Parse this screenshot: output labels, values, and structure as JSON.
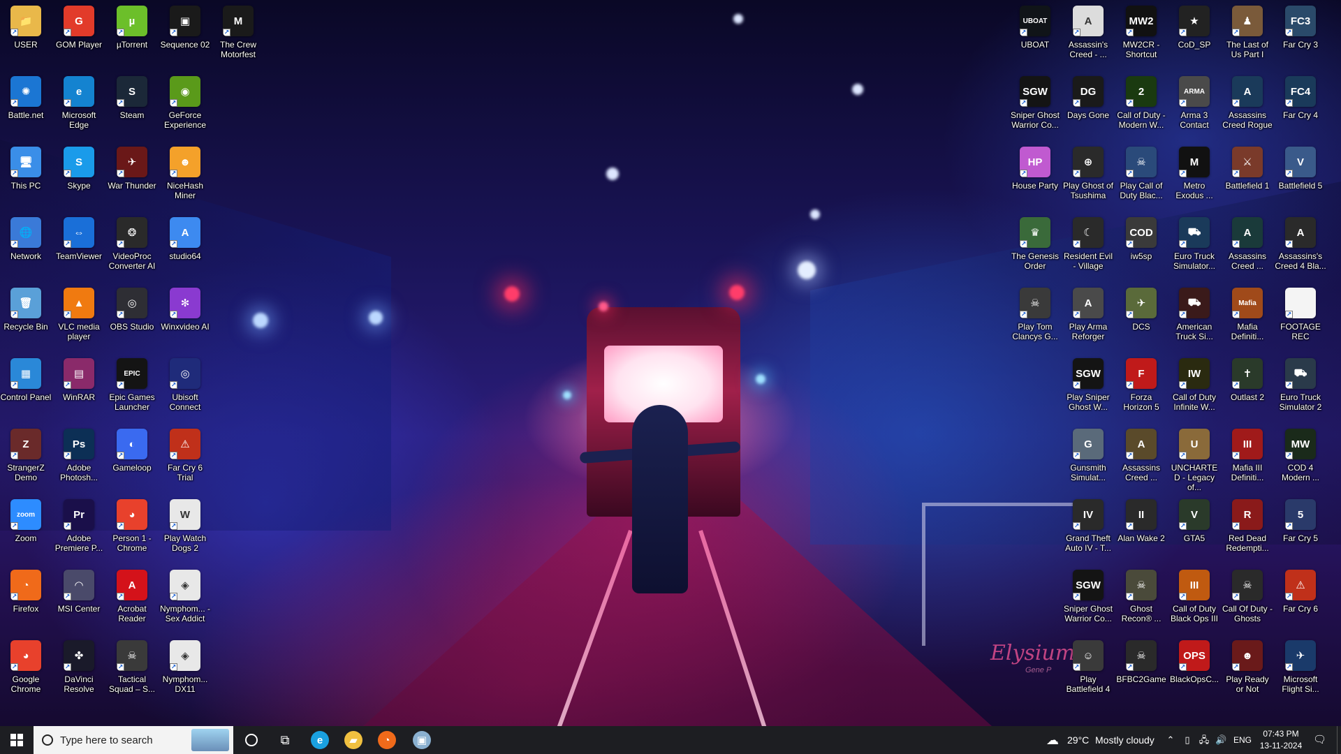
{
  "desktop": {
    "watermark": {
      "text": "Elysium",
      "sub": "Gene P"
    },
    "left_icons": [
      {
        "label": "USER",
        "glyph": "📁",
        "color": "#e9b84a"
      },
      {
        "label": "GOM Player",
        "glyph": "G",
        "color": "#e23b2a"
      },
      {
        "label": "µTorrent",
        "glyph": "µ",
        "color": "#6cbf2a"
      },
      {
        "label": "Sequence 02",
        "glyph": "▣",
        "color": "#1a1a1a"
      },
      {
        "label": "The Crew Motorfest",
        "glyph": "M",
        "color": "#1a1a1a"
      },
      {
        "label": "Battle.net",
        "glyph": "✺",
        "color": "#1b76d3"
      },
      {
        "label": "Microsoft Edge",
        "glyph": "e",
        "color": "#1483d0"
      },
      {
        "label": "Steam",
        "glyph": "S",
        "color": "#1b2838"
      },
      {
        "label": "GeForce Experience",
        "glyph": "◉",
        "color": "#5a9a1a"
      },
      {
        "label": "This PC",
        "glyph": "🖥",
        "color": "#3a8ee8"
      },
      {
        "label": "Skype",
        "glyph": "S",
        "color": "#1a9bea"
      },
      {
        "label": "War Thunder",
        "glyph": "✈",
        "color": "#6a1818"
      },
      {
        "label": "NiceHash Miner",
        "glyph": "☻",
        "color": "#f4a12a"
      },
      {
        "label": "Network",
        "glyph": "🌐",
        "color": "#3a7ad8"
      },
      {
        "label": "TeamViewer",
        "glyph": "⇔",
        "color": "#1a6fd8"
      },
      {
        "label": "VideoProc Converter AI",
        "glyph": "❂",
        "color": "#2a2a2a"
      },
      {
        "label": "studio64",
        "glyph": "A",
        "color": "#3d8af0"
      },
      {
        "label": "Recycle Bin",
        "glyph": "🗑",
        "color": "#5aa0d8"
      },
      {
        "label": "VLC media player",
        "glyph": "▲",
        "color": "#f07a10"
      },
      {
        "label": "OBS Studio",
        "glyph": "◎",
        "color": "#2e2e34"
      },
      {
        "label": "Winxvideo AI",
        "glyph": "✻",
        "color": "#8a3ad0"
      },
      {
        "label": "Control Panel",
        "glyph": "▦",
        "color": "#2a88d8"
      },
      {
        "label": "WinRAR",
        "glyph": "▤",
        "color": "#8a2a6a"
      },
      {
        "label": "Epic Games Launcher",
        "glyph": "EPIC",
        "color": "#141414"
      },
      {
        "label": "Ubisoft Connect",
        "glyph": "◎",
        "color": "#1f2b7a"
      },
      {
        "label": "StrangerZ Demo",
        "glyph": "Z",
        "color": "#6a2a2a"
      },
      {
        "label": "Adobe Photosh...",
        "glyph": "Ps",
        "color": "#0c2f55"
      },
      {
        "label": "Gameloop",
        "glyph": "◐",
        "color": "#3a6af0"
      },
      {
        "label": "Far Cry 6 Trial",
        "glyph": "⚠",
        "color": "#c0301a"
      },
      {
        "label": "Zoom",
        "glyph": "zoom",
        "color": "#2d8cff"
      },
      {
        "label": "Adobe Premiere P...",
        "glyph": "Pr",
        "color": "#1a0f4a"
      },
      {
        "label": "Person 1 - Chrome",
        "glyph": "◕",
        "color": "#e8412c"
      },
      {
        "label": "Play Watch Dogs 2",
        "glyph": "W",
        "color": "#e8e8e8"
      },
      {
        "label": "Firefox",
        "glyph": "◔",
        "color": "#f06a1a"
      },
      {
        "label": "MSI Center",
        "glyph": "◠",
        "color": "#4a4a6a"
      },
      {
        "label": "Acrobat Reader",
        "glyph": "A",
        "color": "#d4121a"
      },
      {
        "label": "Nymphom... - Sex Addict",
        "glyph": "◈",
        "color": "#e8e8e8"
      },
      {
        "label": "Google Chrome",
        "glyph": "◕",
        "color": "#e8412c"
      },
      {
        "label": "DaVinci Resolve",
        "glyph": "✤",
        "color": "#1a1a2a"
      },
      {
        "label": "Tactical Squad – S...",
        "glyph": "☠",
        "color": "#3a3a3a"
      },
      {
        "label": "Nymphom... DX11",
        "glyph": "◈",
        "color": "#e8e8e8"
      }
    ],
    "right_icons": [
      {
        "label": "UBOAT",
        "glyph": "UBOAT",
        "color": "#101418"
      },
      {
        "label": "Assassin's Creed - ...",
        "glyph": "A",
        "color": "#dcdcdc"
      },
      {
        "label": "MW2CR - Shortcut",
        "glyph": "MW2",
        "color": "#111"
      },
      {
        "label": "CoD_SP",
        "glyph": "★",
        "color": "#222"
      },
      {
        "label": "The Last of Us Part I",
        "glyph": "♟",
        "color": "#7a5a3a"
      },
      {
        "label": "Far Cry 3",
        "glyph": "FC3",
        "color": "#2a4a6a"
      },
      {
        "label": "Sniper Ghost Warrior Co...",
        "glyph": "SGW",
        "color": "#141414"
      },
      {
        "label": "Days Gone",
        "glyph": "DG",
        "color": "#1a1a1a"
      },
      {
        "label": "Call of Duty - Modern W...",
        "glyph": "2",
        "color": "#1a3a10"
      },
      {
        "label": "Arma 3 Contact",
        "glyph": "ARMA",
        "color": "#4a4a4a"
      },
      {
        "label": "Assassins Creed Rogue",
        "glyph": "A",
        "color": "#1a3a5a"
      },
      {
        "label": "Far Cry 4",
        "glyph": "FC4",
        "color": "#1a3a5a"
      },
      {
        "label": "House Party",
        "glyph": "HP",
        "color": "#c05ad0"
      },
      {
        "label": "Play Ghost of Tsushima",
        "glyph": "⊕",
        "color": "#2a2a2a"
      },
      {
        "label": "Play Call of Duty Blac...",
        "glyph": "☠",
        "color": "#2a4a7a"
      },
      {
        "label": "Metro Exodus ...",
        "glyph": "M",
        "color": "#111"
      },
      {
        "label": "Battlefield 1",
        "glyph": "⚔",
        "color": "#7a3a2a"
      },
      {
        "label": "Battlefield 5",
        "glyph": "V",
        "color": "#3a5a8a"
      },
      {
        "label": "The Genesis Order",
        "glyph": "♛",
        "color": "#3a6a3a"
      },
      {
        "label": "Resident Evil - Village",
        "glyph": "☾",
        "color": "#2a2a2a"
      },
      {
        "label": "iw5sp",
        "glyph": "COD",
        "color": "#3a3a3a"
      },
      {
        "label": "Euro Truck Simulator...",
        "glyph": "⛟",
        "color": "#1a3a5a"
      },
      {
        "label": "Assassins Creed ...",
        "glyph": "A",
        "color": "#1a3a3a"
      },
      {
        "label": "Assassins's Creed 4 Bla...",
        "glyph": "A",
        "color": "#2a2a2a"
      },
      {
        "label": "Play Tom Clancys G...",
        "glyph": "☠",
        "color": "#3a3a3a"
      },
      {
        "label": "Play Arma Reforger",
        "glyph": "A",
        "color": "#4a4a4a"
      },
      {
        "label": "DCS",
        "glyph": "✈",
        "color": "#5a6a3a"
      },
      {
        "label": "American Truck Si...",
        "glyph": "⛟",
        "color": "#3a1a1a"
      },
      {
        "label": "Mafia Definiti...",
        "glyph": "Mafia",
        "color": "#a04a1a"
      },
      {
        "label": "FOOTAGE REC",
        "glyph": "",
        "color": "#f4f4f4"
      },
      {
        "label": "Play Sniper Ghost W...",
        "glyph": "SGW",
        "color": "#141414"
      },
      {
        "label": "Forza Horizon 5",
        "glyph": "F",
        "color": "#c01a1a"
      },
      {
        "label": "Call of Duty Infinite W...",
        "glyph": "IW",
        "color": "#2a2a10"
      },
      {
        "label": "Outlast 2",
        "glyph": "✝",
        "color": "#2a3a2a"
      },
      {
        "label": "Euro Truck Simulator 2",
        "glyph": "⛟",
        "color": "#2a3a4a"
      },
      {
        "label": "Gunsmith Simulat...",
        "glyph": "G",
        "color": "#5a6a7a"
      },
      {
        "label": "Assassins Creed ...",
        "glyph": "A",
        "color": "#5a4a2a"
      },
      {
        "label": "UNCHARTED - Legacy of...",
        "glyph": "U",
        "color": "#8a6a3a"
      },
      {
        "label": "Mafia III Definiti...",
        "glyph": "III",
        "color": "#a01a1a"
      },
      {
        "label": "COD 4 Modern ...",
        "glyph": "MW",
        "color": "#1a2a1a"
      },
      {
        "label": "Grand Theft Auto IV - T...",
        "glyph": "IV",
        "color": "#2a2a2a"
      },
      {
        "label": "Alan Wake 2",
        "glyph": "II",
        "color": "#2a2a2a"
      },
      {
        "label": "GTA5",
        "glyph": "V",
        "color": "#2a3a2a"
      },
      {
        "label": "Red Dead Redempti...",
        "glyph": "R",
        "color": "#8a1a1a"
      },
      {
        "label": "Far Cry 5",
        "glyph": "5",
        "color": "#2a3a6a"
      },
      {
        "label": "Sniper Ghost Warrior Co...",
        "glyph": "SGW",
        "color": "#141414"
      },
      {
        "label": "Ghost Recon® ...",
        "glyph": "☠",
        "color": "#4a4a3a"
      },
      {
        "label": "Call of Duty Black Ops III",
        "glyph": "III",
        "color": "#c05a10"
      },
      {
        "label": "Call Of Duty - Ghosts",
        "glyph": "☠",
        "color": "#2a2a2a"
      },
      {
        "label": "Far Cry 6",
        "glyph": "⚠",
        "color": "#c0301a"
      },
      {
        "label": "Play Battlefield 4",
        "glyph": "☺",
        "color": "#3a3a3a"
      },
      {
        "label": "BFBC2Game",
        "glyph": "☠",
        "color": "#2a2a2a"
      },
      {
        "label": "BlackOpsC...",
        "glyph": "OPS",
        "color": "#c01a1a"
      },
      {
        "label": "Play Ready or Not",
        "glyph": "☻",
        "color": "#6a1a1a"
      },
      {
        "label": "Microsoft Flight Si...",
        "glyph": "✈",
        "color": "#1a3a6a"
      }
    ]
  },
  "taskbar": {
    "search_placeholder": "Type here to search",
    "pinned": [
      {
        "name": "edge",
        "glyph": "e",
        "color": "#1aa0e0"
      },
      {
        "name": "file-explorer",
        "glyph": "▰",
        "color": "#f0c040"
      },
      {
        "name": "firefox",
        "glyph": "◔",
        "color": "#f06a1a"
      },
      {
        "name": "app",
        "glyph": "▣",
        "color": "#8ab0d0"
      }
    ],
    "weather": {
      "temp": "29°C",
      "condition": "Mostly cloudy"
    },
    "language": "ENG",
    "time": "07:43 PM",
    "date": "13-11-2024"
  }
}
